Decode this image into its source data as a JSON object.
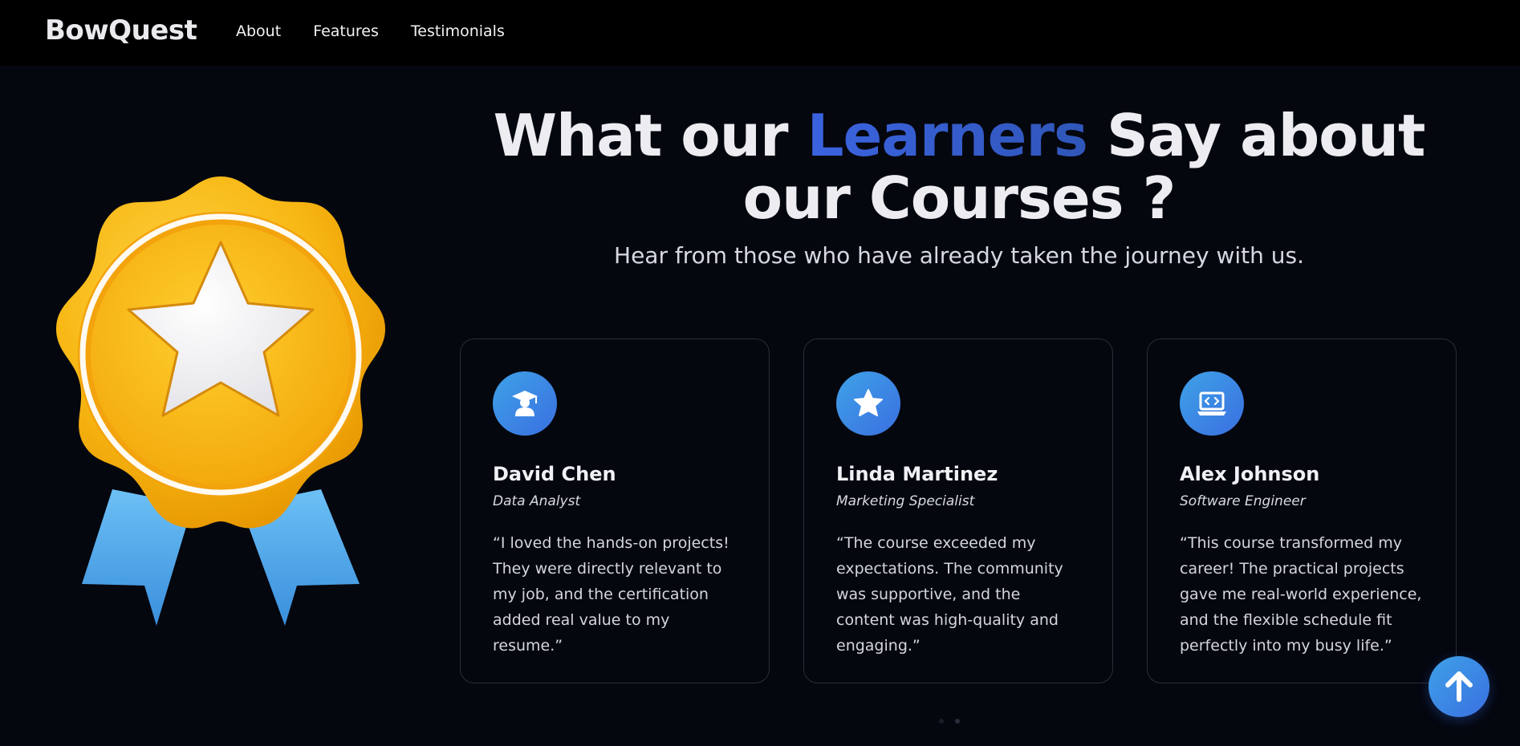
{
  "header": {
    "brand": "BowQuest",
    "nav": [
      {
        "label": "About"
      },
      {
        "label": "Features"
      },
      {
        "label": "Testimonials"
      }
    ]
  },
  "section": {
    "title_pre": "What our ",
    "title_accent": "Learners",
    "title_post": " Say about our Courses ?",
    "subtitle": "Hear from those who have already taken the journey with us."
  },
  "testimonials": [
    {
      "icon": "graduate-icon",
      "name": "David Chen",
      "role": "Data Analyst",
      "quote": "“I loved the hands-on projects! They were directly relevant to my job, and the certification added real value to my resume.”"
    },
    {
      "icon": "star-icon",
      "name": "Linda Martinez",
      "role": "Marketing Specialist",
      "quote": "“The course exceeded my expectations. The community was supportive, and the content was high-quality and engaging.”"
    },
    {
      "icon": "laptop-code-icon",
      "name": "Alex Johnson",
      "role": "Software Engineer",
      "quote": "“This course transformed my career! The practical projects gave me real-world experience, and the flexible schedule fit perfectly into my busy life.”"
    }
  ],
  "colors": {
    "background": "#05070f",
    "accent_blue": "#3b63e0",
    "avatar_gradient_start": "#3ea2e8",
    "avatar_gradient_end": "#3a6fe0",
    "medal_gold": "#f6b414",
    "ribbon_blue": "#4aa6ea"
  }
}
